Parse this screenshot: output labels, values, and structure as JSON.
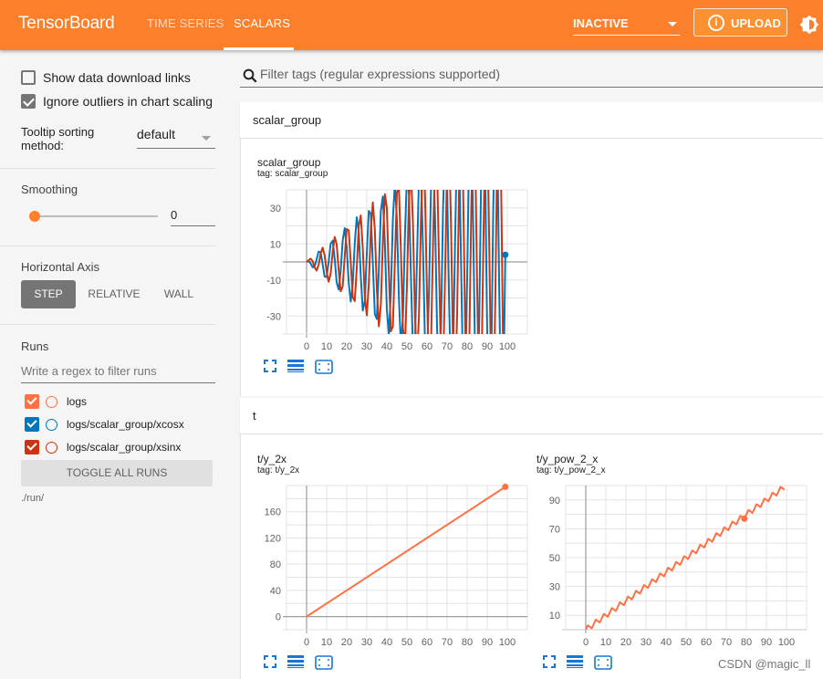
{
  "header": {
    "brand": "TensorBoard",
    "tabs": [
      {
        "label": "TIME SERIES",
        "active": false
      },
      {
        "label": "SCALARS",
        "active": true
      }
    ],
    "run_selector": "INACTIVE",
    "upload_label": "UPLOAD",
    "icons": {
      "upload": "info-icon",
      "theme": "brightness-icon"
    },
    "brand_color": "#fc7f2b"
  },
  "sidebar": {
    "show_download_links": {
      "label": "Show data download links",
      "checked": false
    },
    "ignore_outliers": {
      "label": "Ignore outliers in chart scaling",
      "checked": true
    },
    "tooltip_sorting": {
      "label": "Tooltip sorting method:",
      "value": "default"
    },
    "smoothing": {
      "title": "Smoothing",
      "value": "0",
      "fraction": 0
    },
    "horizontal_axis": {
      "title": "Horizontal Axis",
      "options": [
        "STEP",
        "RELATIVE",
        "WALL"
      ],
      "selected": "STEP"
    },
    "runs": {
      "title": "Runs",
      "filter_placeholder": "Write a regex to filter runs",
      "items": [
        {
          "name": "logs",
          "checked": true,
          "color": "#ff7043"
        },
        {
          "name": "logs/scalar_group/xcosx",
          "checked": true,
          "color": "#0077bb"
        },
        {
          "name": "logs/scalar_group/xsinx",
          "checked": true,
          "color": "#cc3311"
        }
      ],
      "toggle_all_label": "TOGGLE ALL RUNS",
      "directory": "./run/"
    }
  },
  "main": {
    "filter_placeholder": "Filter tags (regular expressions supported)",
    "groups": [
      {
        "name": "scalar_group",
        "cards": [
          {
            "title": "scalar_group",
            "tag": "tag: scalar_group"
          }
        ]
      },
      {
        "name": "t",
        "cards": [
          {
            "title": "t/y_2x",
            "tag": "tag: t/y_2x"
          },
          {
            "title": "t/y_pow_2_x",
            "tag": "tag: t/y_pow_2_x"
          }
        ]
      }
    ],
    "card_icons": [
      "fullscreen-icon",
      "log-scale-icon",
      "fit-domain-icon"
    ]
  },
  "watermark": "CSDN @magic_ll",
  "chart_data": [
    {
      "type": "line",
      "title": "scalar_group",
      "subtitle": "tag: scalar_group",
      "xlabel": "",
      "ylabel": "",
      "xlim": [
        -10,
        110
      ],
      "ylim": [
        -40,
        40
      ],
      "xticks": [
        0,
        10,
        20,
        30,
        40,
        50,
        60,
        70,
        80,
        90,
        100
      ],
      "yticks": [
        -30,
        -10,
        10,
        30
      ],
      "grid": true,
      "series": [
        {
          "name": "logs/scalar_group/xcosx",
          "color": "#0077bb",
          "function": "x*cos(x)",
          "x_range": [
            0,
            99
          ],
          "step": 1
        },
        {
          "name": "logs/scalar_group/xsinx",
          "color": "#cc3311",
          "function": "x*sin(x)",
          "x_range": [
            0,
            99
          ],
          "step": 1
        }
      ],
      "highlight_point": {
        "series": "logs/scalar_group/xcosx",
        "x": 99,
        "y": 4
      }
    },
    {
      "type": "line",
      "title": "t/y_2x",
      "subtitle": "tag: t/y_2x",
      "xlabel": "",
      "ylabel": "",
      "xlim": [
        -10,
        110
      ],
      "ylim": [
        -20,
        200
      ],
      "xticks": [
        0,
        10,
        20,
        30,
        40,
        50,
        60,
        70,
        80,
        90,
        100
      ],
      "yticks": [
        0,
        40,
        80,
        120,
        160
      ],
      "grid": true,
      "series": [
        {
          "name": "logs",
          "color": "#ff7043",
          "function": "2*x",
          "x_range": [
            0,
            99
          ],
          "step": 1
        }
      ],
      "highlight_point": {
        "series": "logs",
        "x": 99,
        "y": 198
      }
    },
    {
      "type": "line",
      "title": "t/y_pow_2_x",
      "subtitle": "tag: t/y_pow_2_x",
      "xlabel": "",
      "ylabel": "",
      "xlim": [
        -10,
        110
      ],
      "ylim": [
        0,
        100
      ],
      "xticks": [
        0,
        10,
        20,
        30,
        40,
        50,
        60,
        70,
        80,
        90,
        100
      ],
      "yticks": [
        10,
        30,
        50,
        70,
        90
      ],
      "grid": true,
      "series": [
        {
          "name": "logs",
          "color": "#ff7043",
          "function": "x + 2*sin(x*1.57)",
          "x_range": [
            0,
            99
          ],
          "step": 1
        }
      ],
      "highlight_point": {
        "series": "logs",
        "x": 79,
        "y": 77
      }
    }
  ]
}
